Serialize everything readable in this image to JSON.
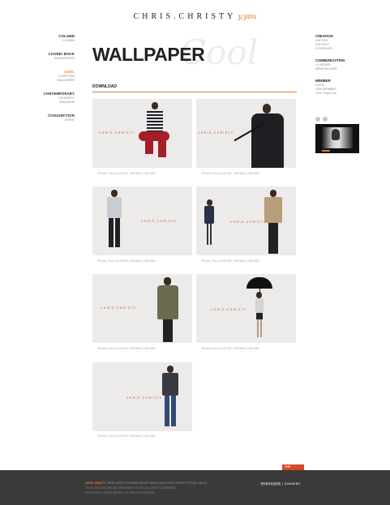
{
  "header": {
    "logo_main": "CHRIS.CHRISTY",
    "logo_sub": "y.you"
  },
  "left_nav": [
    {
      "title": "COLUMN",
      "items": [
        "COLUMN"
      ]
    },
    {
      "title": "COOREI BOOK",
      "items": [
        "MONOWORDS"
      ]
    },
    {
      "title": "COOL",
      "items": [
        "COMPUTER",
        "WALLPAPER"
      ],
      "active": true
    },
    {
      "title": "CONTEMPORARY",
      "items": [
        "CELEBRITY",
        "MAGAZINE"
      ]
    },
    {
      "title": "CONJUNCTION",
      "items": [
        "EVENT"
      ]
    }
  ],
  "right_nav": [
    {
      "title": "CREATION",
      "items": [
        "HISTORY",
        "CONTACT",
        "STORE INFO"
      ]
    },
    {
      "title": "COMMUNICATION",
      "items": [
        "1:1 BOARD",
        "NEWS-BLOGER"
      ]
    },
    {
      "title": "MEMBER",
      "items": [
        "LOGIN",
        "JOIN MEMBER",
        "2013 Thank You"
      ]
    }
  ],
  "page": {
    "title": "WALLPAPER",
    "background_word": "Cool",
    "section": "DOWNLOAD"
  },
  "wallpapers": [
    {
      "brand": "CHRIS.CHRISTY",
      "links": "IPhone | iPad | 1024*768 | 1280*800 | 1440*1280"
    },
    {
      "brand": "CHRIS.CHRISTY",
      "links": "IPhone | iPad | 1024*768 | 1280*800 | 1440*1280"
    },
    {
      "brand": "CHRIS.CHRISTY",
      "links": "IPhone | iPad | 1024*768 | 1280*800 | 1440*1280"
    },
    {
      "brand": "CHRIS.CHRISTY",
      "links": "IPhone | iPad | 1024*768 | 1280*800 | 1440*1280"
    },
    {
      "brand": "CHRIS.CHRISTY",
      "links": "IPhone | iPad | 1024*768 | 1280*800 | 1440*1280"
    },
    {
      "brand": "CHRIS.CHRISTY",
      "links": "IPhone | iPad | 1024*768 | 1280*800 | 1440*1280"
    },
    {
      "brand": "CHRIS.CHRISTY",
      "links": "IPhone | iPad | 1024*768 | 1280*800 | 1440*1280"
    }
  ],
  "top_tab": "TOP",
  "footer": {
    "brand": "CHRIS.CHRISTY",
    "line1": "CHRIS CHRISTY INTERIOR WRITE SHAPES AND CHRIS CHRISTY OFFICE | SEOUL",
    "line2": "TEL 02-733-4100 | INFO@CHRISCHRISTY.CO.KR | ALL RIGHTS RESERVED",
    "line3": "COPYRIGHT © CHRIS.CHRISTY ALL RIGHTS RESERVED",
    "link1": "개인정보취급방침",
    "link2": "COOKIE BIT"
  },
  "colors": {
    "accent": "#e5762a",
    "footer_bg": "#3a3a3a"
  }
}
